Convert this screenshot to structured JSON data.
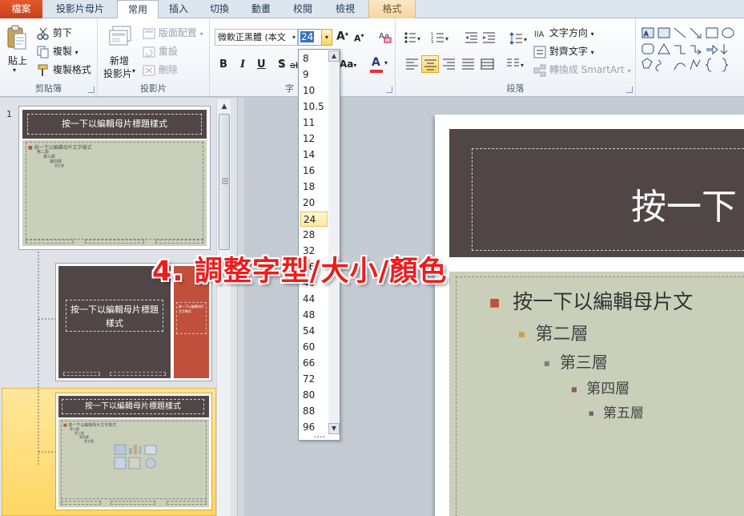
{
  "tabs": [
    {
      "label": "檔案",
      "kind": "file"
    },
    {
      "label": "投影片母片",
      "kind": "normal"
    },
    {
      "label": "常用",
      "kind": "active"
    },
    {
      "label": "插入",
      "kind": "normal"
    },
    {
      "label": "切換",
      "kind": "normal"
    },
    {
      "label": "動畫",
      "kind": "normal"
    },
    {
      "label": "校閱",
      "kind": "normal"
    },
    {
      "label": "檢視",
      "kind": "normal"
    },
    {
      "label": "格式",
      "kind": "context"
    }
  ],
  "clipboard": {
    "paste": "貼上",
    "cut": "剪下",
    "copy": "複製",
    "format_painter": "複製格式",
    "label": "剪貼簿"
  },
  "slides_group": {
    "new_slide_1": "新增",
    "new_slide_2": "投影片",
    "layout": "版面配置",
    "reset": "重設",
    "delete": "刪除",
    "label": "投影片"
  },
  "font": {
    "name": "微軟正黑體 (本文",
    "size": "24",
    "label": "字",
    "bold": "B",
    "italic": "I",
    "underline": "U",
    "shadow": "S",
    "strike": "abc",
    "case": "Aa",
    "color_glyph": "A",
    "font_color": "#e23030"
  },
  "paragraph": {
    "text_direction": "文字方向",
    "align_text": "對齊文字",
    "smartart": "轉換成 SmartArt",
    "label": "段落"
  },
  "font_sizes": [
    "8",
    "9",
    "10",
    "10.5",
    "11",
    "12",
    "14",
    "16",
    "18",
    "20",
    "24",
    "28",
    "32",
    "36",
    "40",
    "44",
    "48",
    "54",
    "60",
    "66",
    "72",
    "80",
    "88",
    "96"
  ],
  "selected_size": "24",
  "thumbnails": {
    "slide_number": "1",
    "master_title": "按一下以編輯母片標題樣式",
    "master_text": "按一下以編輯母片文字樣式",
    "level2": "第二層",
    "level3": "第三層",
    "level4": "第四層",
    "level5": "第五層",
    "layout2_side": "按一下以編輯母片文字樣式"
  },
  "main_slide": {
    "title": "按一下",
    "bullet1": "按一下以編輯母片文",
    "bullet2": "第二層",
    "bullet3": "第三層",
    "bullet4": "第四層",
    "bullet5": "第五層"
  },
  "annotation": "4. 調整字型/大小/顏色",
  "colors": {
    "title_bar": "#514646",
    "body_bg": "#c9cfb9",
    "bullet1": "#c0503c",
    "bullet2": "#c8a04a",
    "annotation": "#ee1c1c",
    "selection": "#ffd764"
  }
}
